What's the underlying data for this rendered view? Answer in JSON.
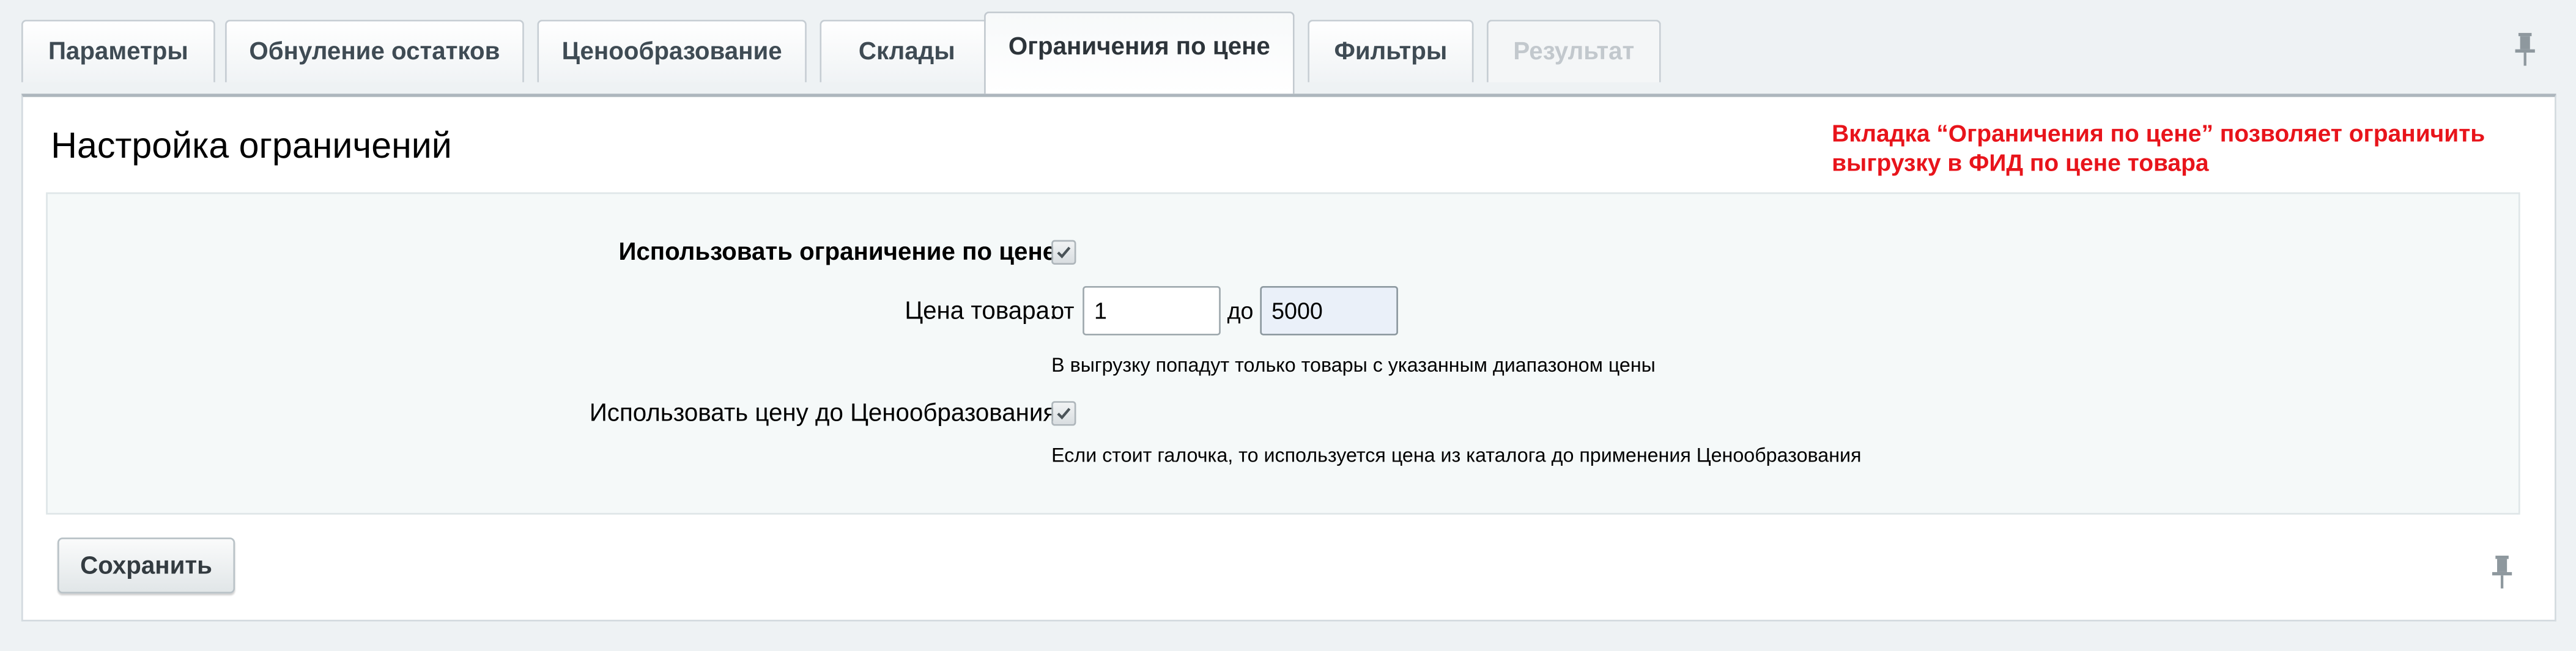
{
  "tabs": [
    {
      "label": "Параметры",
      "state": "normal"
    },
    {
      "label": "Обнуление остатков",
      "state": "normal"
    },
    {
      "label": "Ценообразование",
      "state": "normal"
    },
    {
      "label": "Склады",
      "state": "normal"
    },
    {
      "label": "Ограничения по цене",
      "state": "active"
    },
    {
      "label": "Фильтры",
      "state": "normal"
    },
    {
      "label": "Результат",
      "state": "disabled"
    }
  ],
  "section": {
    "title": "Настройка ограничений",
    "note": "Вкладка “Ограничения по цене”  позволяет ограничить выгрузку в ФИД по цене товара"
  },
  "settings": {
    "use_price_limit": {
      "label": "Использовать ограничение по цене",
      "checked": true
    },
    "price": {
      "label": "Цена товара:",
      "from_label": "от",
      "from_value": "1",
      "to_label": "до",
      "to_value": "5000",
      "hint": "В выгрузку попадут только товары с указанным диапазоном цены"
    },
    "use_pre_pricing": {
      "label": "Использовать цену до Ценообразования",
      "checked": true,
      "hint": "Если стоит галочка, то используется цена из каталога до применения Ценообразования"
    }
  },
  "actions": {
    "save_label": "Сохранить"
  },
  "icons": {
    "pin": "pin-icon",
    "check": "check-icon"
  },
  "colors": {
    "note": "#e8141b",
    "background": "#eef2f4",
    "panel": "#ffffff",
    "settings_bg": "#f5f9f9"
  }
}
